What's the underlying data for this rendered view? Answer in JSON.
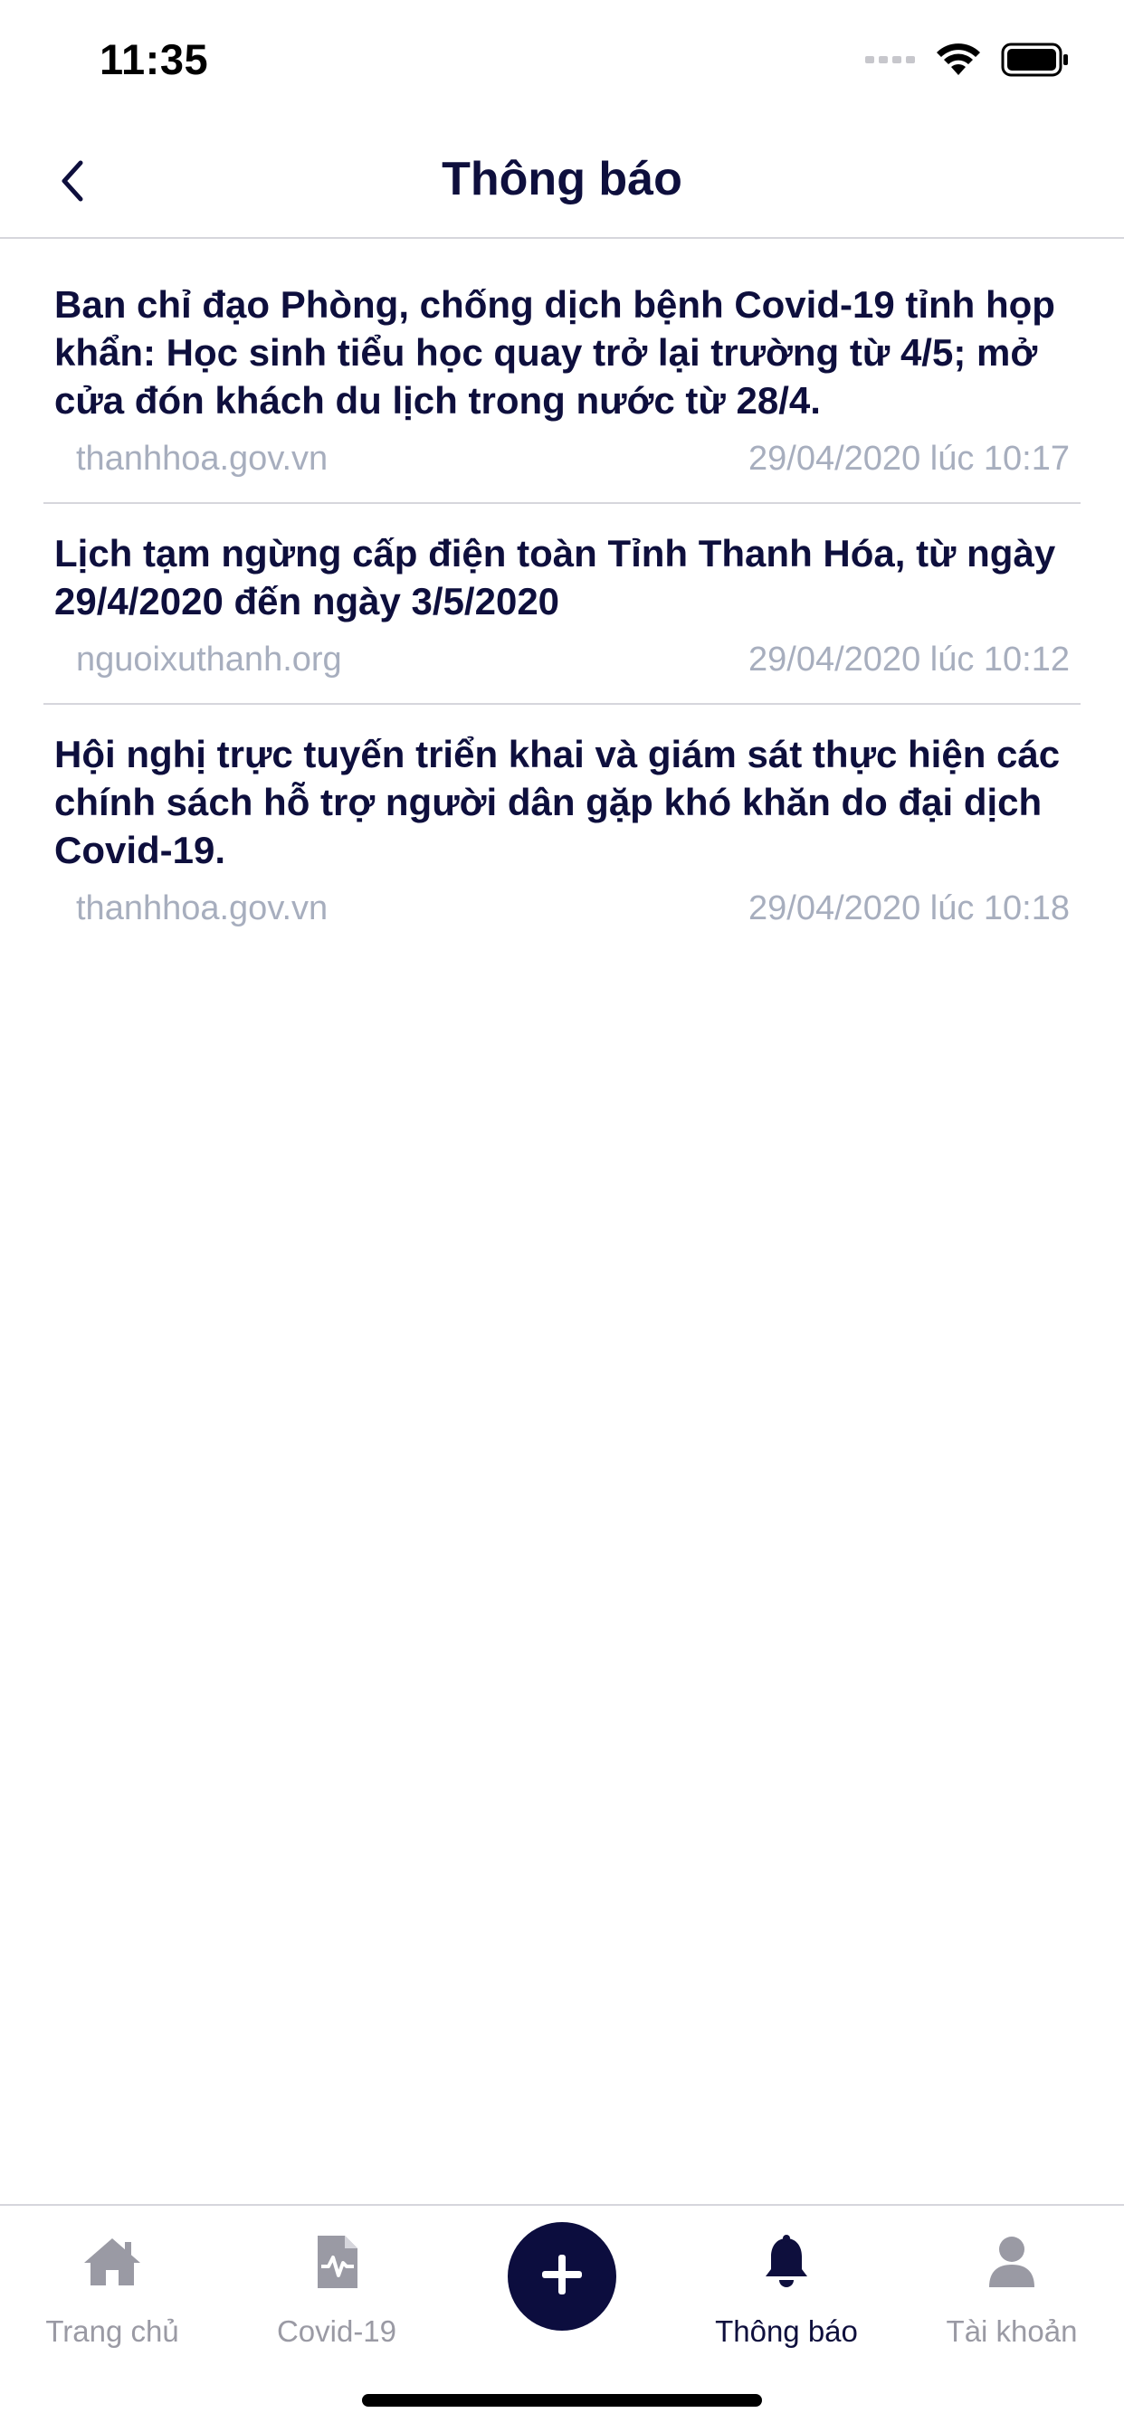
{
  "status_bar": {
    "time": "11:35"
  },
  "nav": {
    "title": "Thông báo"
  },
  "news": [
    {
      "title": "Ban chỉ đạo Phòng, chống dịch bệnh Covid-19 tỉnh họp khẩn: Học sinh tiểu học quay trở lại trường từ 4/5; mở cửa đón khách du lịch trong nước từ 28/4.",
      "source": "thanhhoa.gov.vn",
      "datetime": "29/04/2020 lúc 10:17"
    },
    {
      "title": "Lịch tạm ngừng cấp điện toàn Tỉnh Thanh Hóa, từ ngày 29/4/2020 đến ngày 3/5/2020",
      "source": "nguoixuthanh.org",
      "datetime": "29/04/2020 lúc 10:12"
    },
    {
      "title": "Hội nghị trực tuyến triển khai và giám sát thực hiện các chính sách hỗ trợ người dân gặp khó khăn do đại dịch Covid-19.",
      "source": "thanhhoa.gov.vn",
      "datetime": "29/04/2020 lúc 10:18"
    }
  ],
  "tabs": [
    {
      "label": "Trang chủ",
      "icon": "home-icon"
    },
    {
      "label": "Covid-19",
      "icon": "medical-report-icon"
    },
    {
      "label": "",
      "icon": "plus-icon"
    },
    {
      "label": "Thông báo",
      "icon": "bell-icon",
      "active": true
    },
    {
      "label": "Tài khoản",
      "icon": "user-icon"
    }
  ],
  "colors": {
    "primary": "#0e0f3d",
    "meta_text": "#a7aebe",
    "inactive_tab": "#9a9aa4",
    "divider": "#d6d6dc"
  }
}
